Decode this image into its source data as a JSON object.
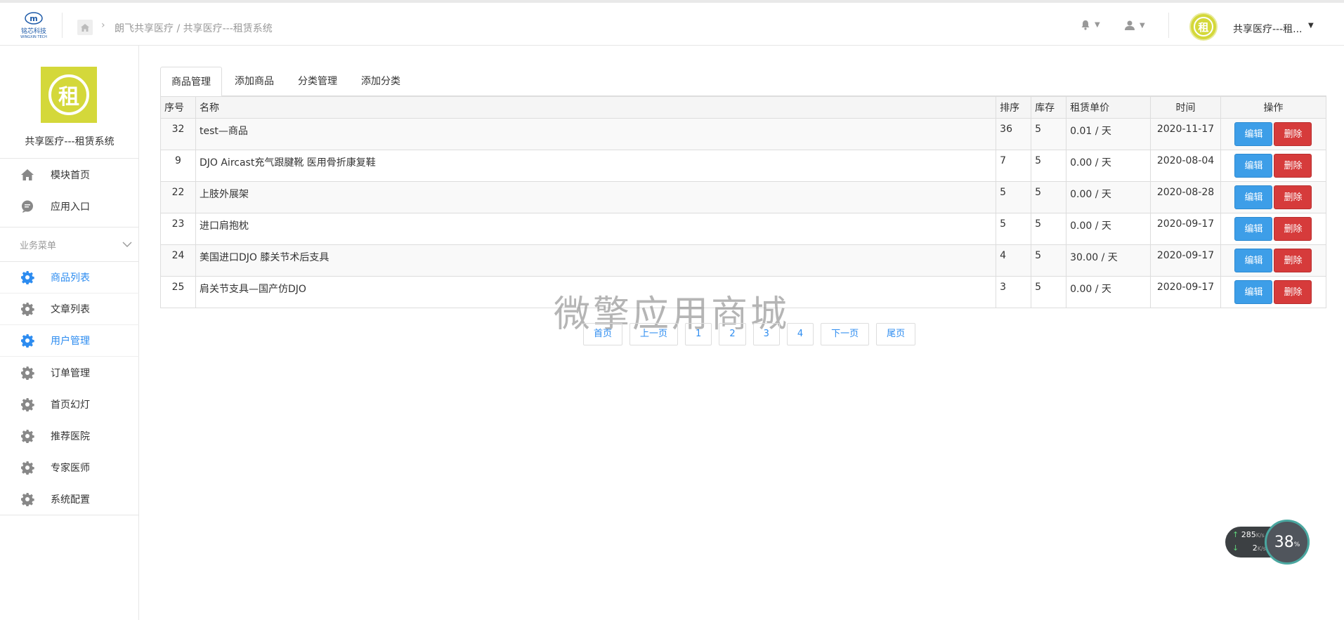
{
  "topbar": {
    "logo_text": "铭芯科技",
    "logo_sub": "WINGXIN TECH",
    "breadcrumb": "朗飞共享医疗 / 共享医疗---租赁系统",
    "account_name": "共享医疗---租...",
    "avatar_char": "租"
  },
  "sidebar": {
    "avatar_char": "租",
    "title": "共享医疗---租赁系统",
    "top_items": [
      {
        "label": "模块首页",
        "icon": "home-icon"
      },
      {
        "label": "应用入口",
        "icon": "chat-icon"
      }
    ],
    "section_label": "业务菜单",
    "menu_items": [
      {
        "label": "商品列表",
        "active": true
      },
      {
        "label": "文章列表",
        "active": false
      },
      {
        "label": "用户管理",
        "active": true
      },
      {
        "label": "订单管理",
        "active": false
      },
      {
        "label": "首页幻灯",
        "active": false
      },
      {
        "label": "推荐医院",
        "active": false
      },
      {
        "label": "专家医师",
        "active": false
      },
      {
        "label": "系统配置",
        "active": false
      }
    ]
  },
  "tabs": [
    "商品管理",
    "添加商品",
    "分类管理",
    "添加分类"
  ],
  "table": {
    "headers": [
      "序号",
      "名称",
      "排序",
      "库存",
      "租赁单价",
      "时间",
      "操作"
    ],
    "edit_label": "编辑",
    "delete_label": "删除",
    "rows": [
      {
        "id": "32",
        "name": "test—商品",
        "sort": "36",
        "stock": "5",
        "price": "0.01 / 天",
        "time": "2020-11-17"
      },
      {
        "id": "9",
        "name": "DJO Aircast充气跟腱靴 医用骨折康复鞋",
        "sort": "7",
        "stock": "5",
        "price": "0.00 / 天",
        "time": "2020-08-04"
      },
      {
        "id": "22",
        "name": "上肢外展架",
        "sort": "5",
        "stock": "5",
        "price": "0.00 / 天",
        "time": "2020-08-28"
      },
      {
        "id": "23",
        "name": "进口肩抱枕",
        "sort": "5",
        "stock": "5",
        "price": "0.00 / 天",
        "time": "2020-09-17"
      },
      {
        "id": "24",
        "name": "美国进口DJO 膝关节术后支具",
        "sort": "4",
        "stock": "5",
        "price": "30.00 / 天",
        "time": "2020-09-17"
      },
      {
        "id": "25",
        "name": "肩关节支具—国产仿DJO",
        "sort": "3",
        "stock": "5",
        "price": "0.00 / 天",
        "time": "2020-09-17"
      }
    ]
  },
  "pager": [
    "首页",
    "上一页",
    "1",
    "2",
    "3",
    "4",
    "下一页",
    "尾页"
  ],
  "watermark": "微擎应用商城",
  "speed": {
    "up": "285",
    "down": "2",
    "unit": "K/s",
    "percent": "38",
    "pct_sign": "%"
  },
  "colors": {
    "accent": "#2d8cf0",
    "edit": "#3d9ee8",
    "delete": "#d63b3b",
    "avatar": "#d4d83a"
  }
}
